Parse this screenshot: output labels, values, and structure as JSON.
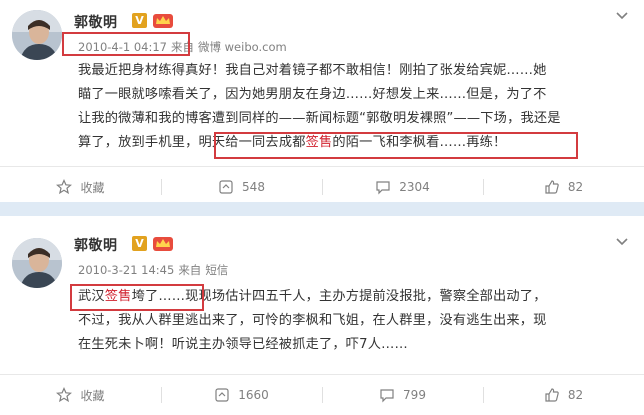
{
  "posts": [
    {
      "username": "郭敬明",
      "vip_badge": "V",
      "timestamp": "2010-4-1 04:17",
      "source_prefix": "来自",
      "source": "微博 weibo.com",
      "lines": [
        {
          "segments": [
            "我最近把身材练得真好！我自己对着镜子都不敢相信！刚拍了张发给宾妮……她"
          ]
        },
        {
          "segments": [
            "瞄了一眼就哆嗦看关了，因为她男朋友在身边……好想发上来……但是，为了不"
          ]
        },
        {
          "segments": [
            "让我的微薄和我的博客遭到同样的——新闻标题“郭敬明发裸照”——下场，我还是"
          ]
        },
        {
          "segments": [
            "算了，放到手机里，",
            "明天给一同去成都",
            "签售",
            "的陌一飞和李枫看……再练！"
          ]
        }
      ],
      "actions": {
        "favorite": "收藏",
        "repost": "548",
        "comment": "2304",
        "like": "82"
      }
    },
    {
      "username": "郭敬明",
      "vip_badge": "V",
      "timestamp": "2010-3-21 14:45",
      "source_prefix": "来自",
      "source": "短信",
      "lines": [
        {
          "segments": [
            "武汉",
            "签售",
            "垮了……",
            "现现场估计四五千人，主办方提前没报批，警察全部出动了，"
          ]
        },
        {
          "segments": [
            "不过，我从人群里逃出来了，可怜的李枫和飞姐，在人群里，没有逃生出来，现"
          ]
        },
        {
          "segments": [
            "在生死未卜啊！听说主办领导已经被抓走了，吓7人……"
          ]
        }
      ],
      "actions": {
        "favorite": "收藏",
        "repost": "1660",
        "comment": "799",
        "like": "82"
      }
    }
  ],
  "colors": {
    "highlight_red": "#d0212e",
    "annotation_box": "#d33b3f",
    "separator": "#dfeaf5",
    "meta_gray": "#808080"
  },
  "icons": [
    "avatar",
    "vip-badge",
    "crown-badge",
    "chevron-down-icon",
    "star-icon",
    "repost-icon",
    "comment-icon",
    "like-icon"
  ]
}
